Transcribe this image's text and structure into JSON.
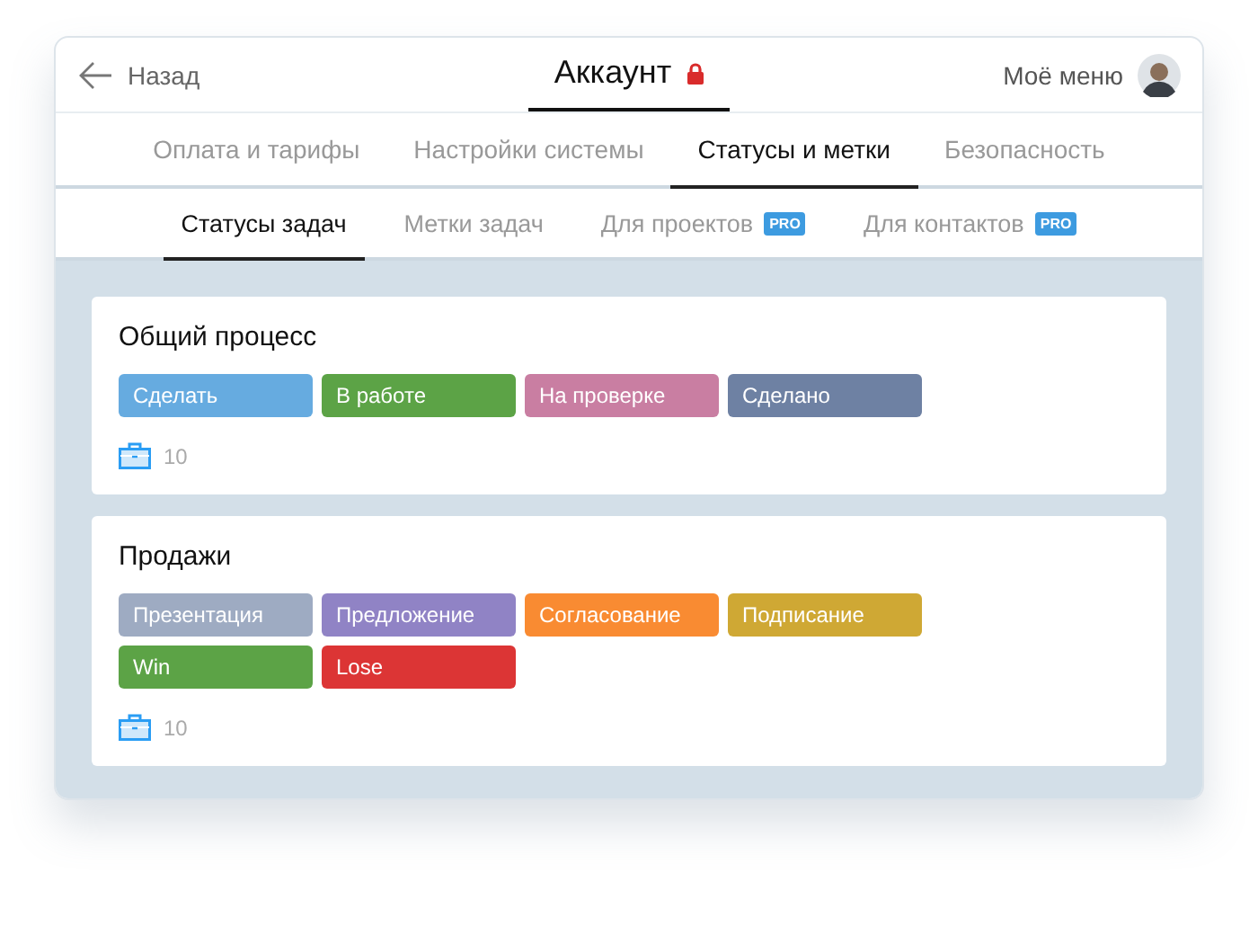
{
  "header": {
    "back": "Назад",
    "title": "Аккаунт",
    "locked": true,
    "menu": "Моё меню"
  },
  "tabs": [
    {
      "label": "Оплата и тарифы",
      "selected": false
    },
    {
      "label": "Настройки системы",
      "selected": false
    },
    {
      "label": "Статусы и метки",
      "selected": true
    },
    {
      "label": "Безопасность",
      "selected": false
    }
  ],
  "subtabs": [
    {
      "label": "Статусы задач",
      "selected": true
    },
    {
      "label": "Метки задач",
      "selected": false
    },
    {
      "label": "Для проектов",
      "selected": false,
      "badge": "PRO"
    },
    {
      "label": "Для контактов",
      "selected": false,
      "badge": "PRO"
    }
  ],
  "processes": [
    {
      "title": "Общий процесс",
      "count": "10",
      "statuses": [
        {
          "label": "Сделать",
          "color": "#66abe0"
        },
        {
          "label": "В работе",
          "color": "#5ca346"
        },
        {
          "label": "На проверке",
          "color": "#c97ea2"
        },
        {
          "label": "Сделано",
          "color": "#6e81a3"
        }
      ]
    },
    {
      "title": "Продажи",
      "count": "10",
      "statuses": [
        {
          "label": "Презентация",
          "color": "#9eabc2"
        },
        {
          "label": "Предложение",
          "color": "#9083c5"
        },
        {
          "label": "Согласование",
          "color": "#f98b32"
        },
        {
          "label": "Подписание",
          "color": "#cfa834"
        },
        {
          "label": "Win",
          "color": "#5ca346"
        },
        {
          "label": "Lose",
          "color": "#dc3535"
        }
      ]
    }
  ]
}
